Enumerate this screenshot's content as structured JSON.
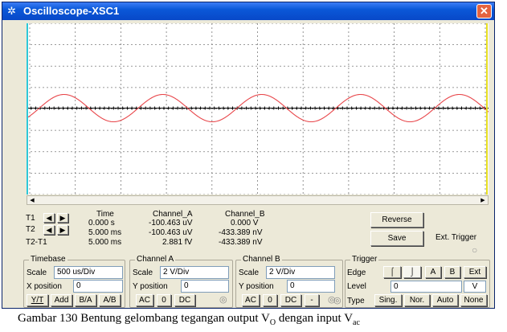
{
  "window": {
    "title": "Oscilloscope-XSC1"
  },
  "cursors": {
    "header": {
      "time": "Time",
      "cha": "Channel_A",
      "chb": "Channel_B"
    },
    "rows": [
      {
        "label": "T1",
        "time": "0.000 s",
        "cha": "-100.463 uV",
        "chb": "0.000 V"
      },
      {
        "label": "T2",
        "time": "5.000 ms",
        "cha": "-100.463 uV",
        "chb": "-433.389 nV"
      },
      {
        "label": "T2-T1",
        "time": "5.000 ms",
        "cha": "2.881 fV",
        "chb": "-433.389 nV"
      }
    ]
  },
  "buttons": {
    "reverse": "Reverse",
    "save": "Save",
    "ext_trigger": "Ext. Trigger"
  },
  "timebase": {
    "title": "Timebase",
    "scale_label": "Scale",
    "scale_value": "500 us/Div",
    "xpos_label": "X position",
    "xpos_value": "0",
    "modes": [
      "Y/T",
      "Add",
      "B/A",
      "A/B"
    ]
  },
  "channel_a": {
    "title": "Channel A",
    "scale_label": "Scale",
    "scale_value": "2 V/Div",
    "ypos_label": "Y position",
    "ypos_value": "0",
    "coupling": [
      "AC",
      "0",
      "DC"
    ]
  },
  "channel_b": {
    "title": "Channel B",
    "scale_label": "Scale",
    "scale_value": "2 V/Div",
    "ypos_label": "Y position",
    "ypos_value": "0",
    "coupling": [
      "AC",
      "0",
      "DC",
      "-"
    ]
  },
  "trigger": {
    "title": "Trigger",
    "edge_label": "Edge",
    "edge_buttons": [
      "A",
      "B",
      "Ext"
    ],
    "level_label": "Level",
    "level_value": "0",
    "level_unit": "V",
    "type_label": "Type",
    "types": [
      "Sing.",
      "Nor.",
      "Auto",
      "None"
    ]
  },
  "caption": {
    "prefix": "Gambar 130 Bentung gelombang tegangan output V",
    "sub1": "O",
    "middle": " dengan input V",
    "sub2": "ac"
  },
  "colors": {
    "trace": "#e8464a",
    "grid": "#7a7a7a",
    "cursor1": "#2ec8d8",
    "cursor2": "#e8e020"
  }
}
